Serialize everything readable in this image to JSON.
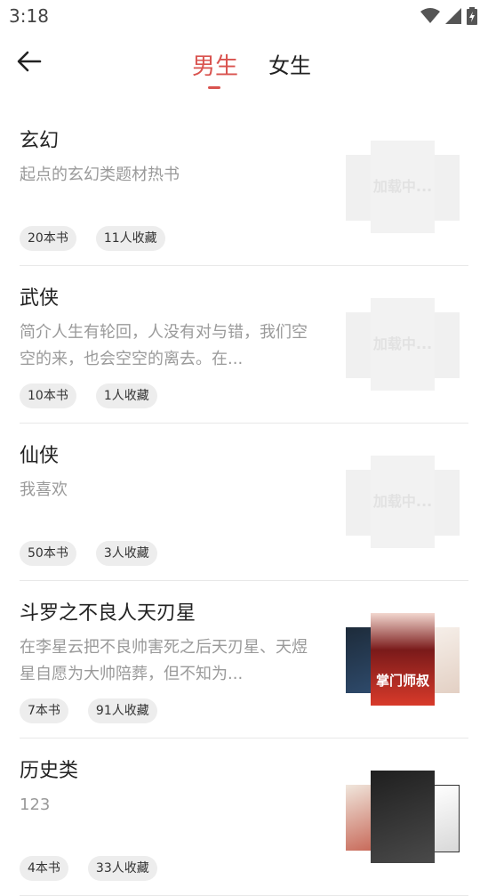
{
  "status_bar": {
    "time": "3:18",
    "icons": [
      "wifi-icon",
      "signal-icon",
      "battery-icon"
    ]
  },
  "header": {
    "tabs": [
      {
        "label": "男生",
        "active": true
      },
      {
        "label": "女生",
        "active": false
      }
    ],
    "accent_color": "#d9534f"
  },
  "items": [
    {
      "title": "玄幻",
      "description": "起点的玄幻类题材热书",
      "books": "20本书",
      "favorites": "11人收藏",
      "cover": {
        "front_text": "加载中...",
        "side_text": "加载中..."
      }
    },
    {
      "title": "武侠",
      "description": "简介人生有轮回，人没有对与错，我们空空的来，也会空空的离去。在...",
      "books": "10本书",
      "favorites": "1人收藏",
      "cover": {
        "front_text": "加载中...",
        "side_text": "加载中..."
      }
    },
    {
      "title": "仙侠",
      "description": "我喜欢",
      "books": "50本书",
      "favorites": "3人收藏",
      "cover": {
        "front_text": "加载中...",
        "side_text": "加载中..."
      }
    },
    {
      "title": "斗罗之不良人天刃星",
      "description": "在李星云把不良帅害死之后天刃星、天煜星自愿为大帅陪葬，但不知为...",
      "books": "7本书",
      "favorites": "91人收藏",
      "cover": {
        "front_text": "掌门师叔",
        "side_text": ""
      }
    },
    {
      "title": "历史类",
      "description": "123",
      "books": "4本书",
      "favorites": "33人收藏",
      "cover": {
        "front_text": "",
        "side_text": ""
      }
    }
  ]
}
